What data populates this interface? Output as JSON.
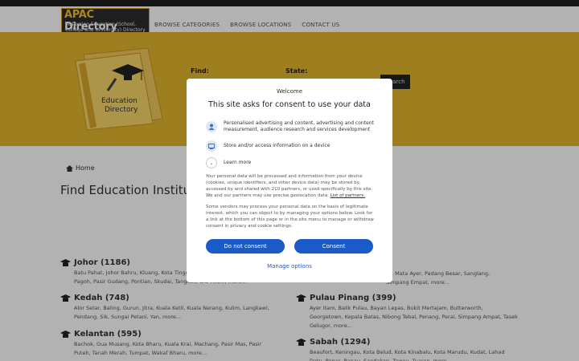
{
  "header": {
    "logo_title_a": "APAC",
    "logo_title_b": "Directory",
    "logo_subtitle": "Malaysian Education (School, College and University) Directory",
    "nav": [
      "BROWSE CATEGORIES",
      "BROWSE LOCATIONS",
      "CONTACT US"
    ]
  },
  "hero": {
    "book_label_1": "Education",
    "book_label_2": "Directory",
    "find_label": "Find:",
    "state_label": "State:",
    "search_button": "Search"
  },
  "breadcrumb": {
    "home": "Home"
  },
  "page_title": "Find Education Institut",
  "states": {
    "johor": {
      "name": "Johor (1186)",
      "towns": "Batu Pahat,   Johor Bahru,   Kluang,   Kota Tingg\nPagoh,   Pasir Gudang,   Pontian,   Skudai,   Tangkak,   Ulu Tiram,   more..."
    },
    "perlis": {
      "towns": "lis,   Mata Ayer,   Padang Besar,   Sanglang,\nSimpang Empat,   more..."
    },
    "kedah": {
      "name": "Kedah (748)",
      "towns": "Alor Setar,   Baling,   Gurun,   Jitra,   Kuala Ketil,   Kuala Nerang,   Kulim,   Langkawi,\nPendang,   Sik,   Sungai Petani,   Yan,   more..."
    },
    "pulau_pinang": {
      "name": "Pulau Pinang (399)",
      "towns": "Ayer Itam,   Balik Pulau,   Bayan Lepas,   Bukit Mertajam,   Butterworth,\nGeorgetown,   Kepala Batas,   Nibong Tebal,   Penang,   Perai,   Simpang Ampat,   Tasek\nGelugor,   more..."
    },
    "kelantan": {
      "name": "Kelantan (595)",
      "towns": "Bachok,   Gua Musang,   Kota Bharu,   Kuala Krai,   Machang,   Pasir Mas,   Pasir\nPuteh,   Tanah Merah,   Tumpat,   Wakaf Bharu,   more..."
    },
    "sabah": {
      "name": "Sabah (1294)",
      "towns": "Beaufort,   Keningau,   Kota Belud,   Kota Kinabalu,   Kota Marudu,   Kudat,   Lahad\nDatu,   Papar,   Ranau,   Sandakan,   Tawau,   Tuaran,   more..."
    }
  },
  "consent": {
    "welcome": "Welcome",
    "title": "This site asks for consent to use your data",
    "purposes": [
      "Personalised advertising and content, advertising and content measurement, audience research and services development",
      "Store and/or access information on a device"
    ],
    "learn_more": "Learn more",
    "para1": "Your personal data will be processed and information from your device (cookies, unique identifiers, and other device data) may be stored by, accessed by and shared with 210 partners, or used specifically by this site. We and our partners may use precise geolocation data.",
    "para1_link": "List of partners.",
    "para2": "Some vendors may process your personal data on the basis of legitimate interest, which you can object to by managing your options below. Look for a link at the bottom of this page or in the site menu to manage or withdraw consent in privacy and cookie settings.",
    "do_not_consent": "Do not consent",
    "consent": "Consent",
    "manage_options": "Manage options"
  },
  "colors": {
    "hero_bg": "#e2b72f",
    "accent_blue": "#1a5bc9"
  }
}
